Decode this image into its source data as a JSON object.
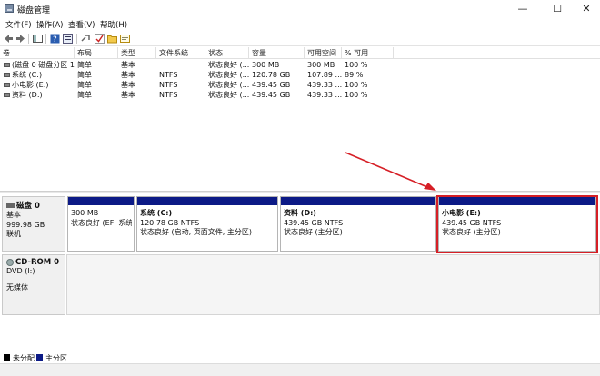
{
  "window": {
    "title": "磁盘管理",
    "min_glyph": "—",
    "max_glyph": "☐",
    "close_glyph": "✕"
  },
  "menu": [
    "文件(F)",
    "操作(A)",
    "查看(V)",
    "帮助(H)"
  ],
  "toolbar_icons": [
    "back-icon",
    "forward-icon",
    "console-tree-icon",
    "help-icon",
    "properties-icon",
    "check-icon",
    "folder-icon",
    "export-icon"
  ],
  "volume_table": {
    "headers": [
      "卷",
      "布局",
      "类型",
      "文件系统",
      "状态",
      "容量",
      "可用空间",
      "% 可用"
    ],
    "rows": [
      [
        "(磁盘 0 磁盘分区 1)",
        "简单",
        "基本",
        "",
        "状态良好 (...",
        "300 MB",
        "300 MB",
        "100 %"
      ],
      [
        "系统 (C:)",
        "简单",
        "基本",
        "NTFS",
        "状态良好 (...",
        "120.78 GB",
        "107.89 ...",
        "89 %"
      ],
      [
        "小电影 (E:)",
        "简单",
        "基本",
        "NTFS",
        "状态良好 (...",
        "439.45 GB",
        "439.33 ...",
        "100 %"
      ],
      [
        "资料 (D:)",
        "简单",
        "基本",
        "NTFS",
        "状态良好 (...",
        "439.45 GB",
        "439.33 ...",
        "100 %"
      ]
    ]
  },
  "disk0": {
    "name": "磁盘 0",
    "type": "基本",
    "size": "999.98 GB",
    "status": "联机",
    "partitions": [
      {
        "name": "",
        "size": "300 MB",
        "status": "状态良好 (EFI 系统分"
      },
      {
        "name": "系统  (C:)",
        "size": "120.78 GB NTFS",
        "status": "状态良好 (启动, 页面文件, 主分区)"
      },
      {
        "name": "资料  (D:)",
        "size": "439.45 GB NTFS",
        "status": "状态良好 (主分区)"
      },
      {
        "name": "小电影  (E:)",
        "size": "439.45 GB NTFS",
        "status": "状态良好 (主分区)"
      }
    ]
  },
  "cdrom": {
    "name": "CD-ROM 0",
    "drive": "DVD (I:)",
    "status": "无媒体"
  },
  "legend": [
    {
      "label": "未分配",
      "color": "#000000"
    },
    {
      "label": "主分区",
      "color": "#0c1a86"
    }
  ],
  "colors": {
    "partition_bar": "#0c1a86",
    "highlight": "#d61f26"
  }
}
